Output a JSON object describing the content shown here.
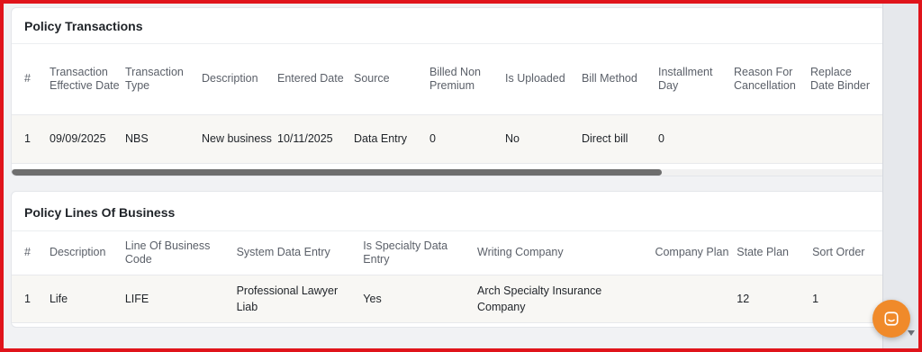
{
  "transactions": {
    "title": "Policy Transactions",
    "columns": [
      "#",
      "Transaction Effective Date",
      "Transaction Type",
      "Description",
      "Entered Date",
      "Source",
      "Billed Non Premium",
      "Is Uploaded",
      "Bill Method",
      "Installment Day",
      "Reason For Cancellation",
      "Replace Date Binder"
    ],
    "rows": [
      [
        "1",
        "09/09/2025",
        "NBS",
        "New business",
        "10/11/2025",
        "Data Entry",
        "0",
        "No",
        "Direct bill",
        "0",
        "",
        ""
      ]
    ]
  },
  "lines_of_business": {
    "title": "Policy Lines Of Business",
    "columns": [
      "#",
      "Description",
      "Line Of Business Code",
      "System Data Entry",
      "Is Specialty Data Entry",
      "Writing Company",
      "Company Plan",
      "State Plan",
      "Sort Order"
    ],
    "rows": [
      [
        "1",
        "Life",
        "LIFE",
        "Professional Lawyer Liab",
        "Yes",
        "Arch Specialty Insurance Company",
        "",
        "12",
        "1"
      ]
    ]
  },
  "chat": {
    "icon": "chat-icon"
  },
  "colors": {
    "frame_border": "#e0141b",
    "chat_accent": "#f08a2a"
  }
}
